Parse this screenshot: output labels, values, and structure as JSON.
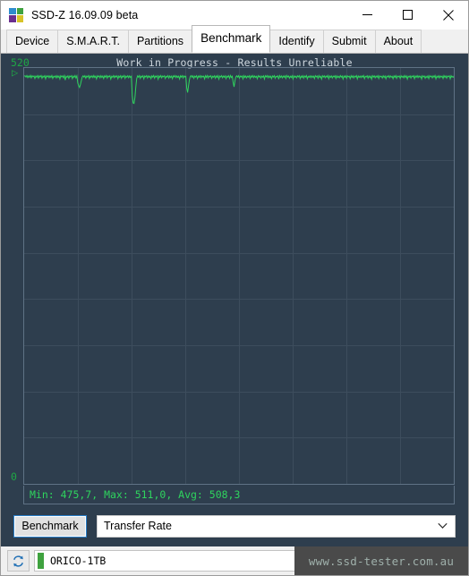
{
  "window": {
    "title": "SSD-Z 16.09.09 beta",
    "icon": "app-squares-icon",
    "controls": {
      "minimize": "minimize-icon",
      "maximize": "maximize-icon",
      "close": "close-icon"
    }
  },
  "tabs": [
    {
      "label": "Device",
      "selected": false
    },
    {
      "label": "S.M.A.R.T.",
      "selected": false
    },
    {
      "label": "Partitions",
      "selected": false
    },
    {
      "label": "Benchmark",
      "selected": true
    },
    {
      "label": "Identify",
      "selected": false
    },
    {
      "label": "Submit",
      "selected": false
    },
    {
      "label": "About",
      "selected": false
    }
  ],
  "benchmark": {
    "warning_title": "Work in Progress - Results Unreliable",
    "axis_max_label": "520",
    "axis_min_label": "0",
    "start_marker": "▷",
    "stats_line": "Min: 475,7, Max: 511,0, Avg: 508,3",
    "run_button_label": "Benchmark",
    "mode_value": "Transfer Rate",
    "mode_options": [
      "Transfer Rate"
    ],
    "colors": {
      "panel_bg": "#2e3e4e",
      "plot_border": "#5f7285",
      "grid": "#3d4d5d",
      "trace": "#2fd45e",
      "axis_text": "#1fa845",
      "title_text": "#cfd8df"
    }
  },
  "chart_data": {
    "type": "line",
    "title": "Work in Progress - Results Unreliable",
    "xlabel": "",
    "ylabel": "",
    "ylim": [
      0,
      520
    ],
    "ytick_labels": [
      "520",
      "0"
    ],
    "grid": true,
    "grid_rows": 9,
    "grid_cols": 8,
    "legend": "none",
    "units": "MB/s",
    "stats": {
      "min": 475.7,
      "max": 511.0,
      "avg": 508.3
    },
    "series": [
      {
        "name": "Transfer Rate",
        "color": "#2fd45e",
        "values": [
          509.8,
          510.2,
          508.6,
          510.6,
          507.9,
          510.1,
          508.3,
          510.7,
          507.6,
          510.3,
          508.9,
          510.0,
          506.8,
          509.9,
          508.4,
          510.5,
          507.3,
          510.2,
          508.8,
          510.6,
          507.1,
          509.8,
          508.5,
          510.4,
          506.4,
          510.1,
          508.7,
          510.3,
          507.8,
          510.0,
          508.2,
          510.6,
          506.9,
          509.7,
          508.6,
          510.2,
          507.5,
          510.4,
          508.1,
          509.9,
          506.2,
          510.3,
          508.8,
          510.1,
          507.7,
          510.5,
          504.9,
          509.6,
          508.4,
          510.2,
          507.0,
          510.0,
          508.9,
          510.4,
          506.6,
          509.8,
          508.3,
          510.6,
          507.4,
          510.1,
          501.2,
          497.8,
          495.6,
          499.3,
          504.1,
          508.7,
          510.2,
          508.5,
          510.3,
          507.2,
          509.9,
          508.6,
          510.5,
          506.7,
          510.0,
          508.4,
          510.2,
          507.9,
          510.6,
          508.1,
          509.8,
          506.3,
          510.3,
          508.7,
          510.1,
          507.6,
          510.4,
          508.2,
          509.9,
          506.8,
          510.2,
          508.5,
          510.6,
          507.3,
          510.0,
          508.8,
          510.3,
          506.1,
          509.7,
          508.4,
          510.5,
          507.8,
          510.1,
          508.6,
          510.2,
          506.5,
          509.9,
          508.3,
          510.4,
          507.1,
          510.0,
          508.7,
          510.6,
          506.9,
          509.8,
          508.5,
          510.3,
          507.7,
          510.1,
          508.2,
          509.6,
          485.4,
          476.2,
          475.7,
          482.9,
          496.3,
          506.8,
          510.2,
          508.4,
          510.5,
          507.0,
          509.9,
          508.6,
          510.3,
          506.4,
          510.0,
          508.8,
          510.4,
          507.5,
          510.1,
          508.3,
          509.8,
          506.7,
          510.2,
          508.5,
          510.6,
          507.2,
          509.9,
          508.7,
          510.3,
          506.0,
          510.1,
          508.4,
          510.5,
          507.6,
          510.0,
          508.9,
          510.2,
          506.8,
          509.7,
          508.6,
          510.4,
          507.3,
          510.1,
          508.1,
          509.9,
          506.5,
          510.3,
          508.8,
          510.6,
          507.9,
          510.0,
          508.2,
          509.8,
          506.2,
          510.2,
          508.5,
          510.4,
          507.4,
          510.1,
          508.7,
          509.6,
          494.8,
          489.3,
          497.6,
          505.2,
          509.4,
          510.5,
          508.3,
          510.2,
          507.1,
          509.9,
          508.6,
          510.3,
          506.6,
          510.0,
          508.4,
          510.5,
          507.8,
          510.1,
          508.8,
          509.8,
          506.3,
          510.4,
          508.2,
          510.6,
          507.5,
          510.0,
          508.9,
          510.3,
          506.9,
          509.7,
          508.5,
          510.2,
          507.2,
          510.1,
          508.3,
          510.5,
          506.1,
          509.9,
          508.7,
          510.4,
          507.7,
          510.0,
          508.4,
          510.2,
          506.7,
          509.8,
          508.6,
          510.3,
          507.0,
          510.6,
          508.1,
          509.6,
          501.8,
          496.4,
          503.7,
          508.9,
          510.2,
          508.5,
          510.4,
          507.3,
          509.9,
          508.8,
          510.1,
          506.4,
          510.5,
          508.2,
          510.0,
          507.6,
          509.8,
          508.6,
          510.3,
          506.8,
          510.2,
          508.4,
          510.6,
          507.9,
          510.1,
          508.3,
          509.7,
          506.5,
          510.4,
          508.7,
          510.0,
          507.4,
          509.9,
          508.5,
          510.2,
          506.2,
          510.3,
          508.8,
          510.5,
          507.8,
          510.1,
          508.1,
          509.8,
          506.6,
          510.0,
          508.6,
          510.4,
          507.1,
          509.6,
          508.9,
          510.2,
          506.0,
          510.5,
          508.3,
          510.1,
          507.5,
          509.9,
          508.4,
          510.3,
          506.9,
          510.6,
          508.7,
          510.0,
          507.2,
          509.7,
          508.2,
          510.4,
          506.3,
          510.1,
          508.5,
          509.8,
          507.6,
          510.2,
          508.8,
          510.5,
          506.7,
          509.9,
          508.1,
          510.3,
          507.3,
          510.0,
          508.6,
          510.6,
          506.4,
          509.6,
          508.4,
          510.2,
          507.9,
          510.1,
          508.3,
          509.8,
          506.8,
          510.4,
          508.9,
          510.0,
          507.0,
          510.5,
          508.2,
          509.7,
          506.1,
          510.3,
          508.7,
          510.2,
          507.7,
          509.9,
          508.5,
          510.6,
          506.5,
          510.0,
          508.3,
          510.1,
          507.4,
          509.8,
          508.8,
          510.4,
          506.9,
          510.2,
          508.1,
          509.6,
          507.8,
          510.5,
          508.6,
          510.0,
          506.2,
          509.9,
          508.4,
          510.3,
          507.1,
          510.1,
          508.9,
          509.7,
          506.6,
          510.4,
          508.2,
          510.2,
          507.5,
          509.8,
          508.7,
          510.5,
          506.3,
          510.0,
          508.3,
          509.9,
          507.9,
          510.1,
          508.5,
          510.6,
          506.7,
          509.6,
          508.8,
          510.3,
          507.2,
          510.0,
          508.1,
          509.8,
          506.0,
          510.4,
          508.6,
          510.2,
          507.6,
          509.9,
          508.4,
          510.5,
          506.8,
          510.1,
          508.9,
          509.7,
          507.3,
          510.3,
          508.2,
          510.0,
          506.4,
          509.8,
          508.7,
          510.4,
          507.8,
          510.2,
          508.5,
          509.6,
          506.5,
          510.1,
          508.3,
          510.5,
          507.0,
          509.9,
          508.8,
          510.0,
          506.9,
          510.3,
          508.4,
          509.8,
          507.7,
          510.6,
          508.2,
          510.1,
          506.1,
          509.7,
          508.6,
          510.2,
          507.4,
          510.0,
          508.9,
          510.4,
          506.6,
          509.9,
          508.3,
          510.5,
          507.9,
          510.1,
          508.5,
          509.8,
          506.2,
          510.3,
          508.7,
          510.0,
          507.1,
          509.6,
          508.1,
          510.2,
          506.7,
          510.4,
          508.8,
          509.9,
          507.5,
          510.1,
          508.4,
          510.6,
          506.3,
          509.7,
          508.2,
          510.3,
          507.6,
          510.0,
          508.6,
          509.8,
          506.8,
          510.5,
          508.3,
          510.1,
          507.2,
          509.9,
          508.9,
          510.2,
          506.5,
          510.4,
          508.5,
          509.6,
          507.8
        ]
      }
    ]
  },
  "statusbar": {
    "refresh_icon": "refresh-icon",
    "device_name": "ORICO-1TB",
    "device_indicator_color": "#3fa23f",
    "watermark": "www.ssd-tester.com.au"
  }
}
